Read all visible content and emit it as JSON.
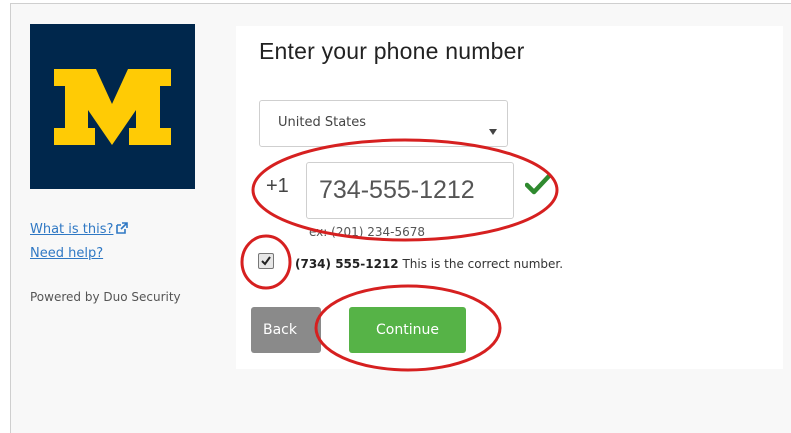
{
  "logo": {
    "name": "University of Michigan block M logo",
    "icon": "block-m-logo"
  },
  "sidebar": {
    "what_is_this": "What is this?",
    "need_help": "Need help?",
    "powered_by": "Powered by Duo Security"
  },
  "form": {
    "title": "Enter your phone number",
    "country_selected": "United States",
    "prefix": "+1",
    "phone_value": "734-555-1212",
    "example": "ex: (201) 234-5678",
    "confirm_number": "(734) 555-1212",
    "confirm_text": " This is the correct number.",
    "confirm_checked": true
  },
  "buttons": {
    "back_label": "Back",
    "continue_label": "Continue"
  },
  "colors": {
    "logo_bg": "#00274c",
    "logo_m": "#ffcb05",
    "continue": "#56b347",
    "back": "#8a8a8a",
    "link": "#2f78c4",
    "annotation": "#d62020",
    "check": "#2f8a2f"
  }
}
